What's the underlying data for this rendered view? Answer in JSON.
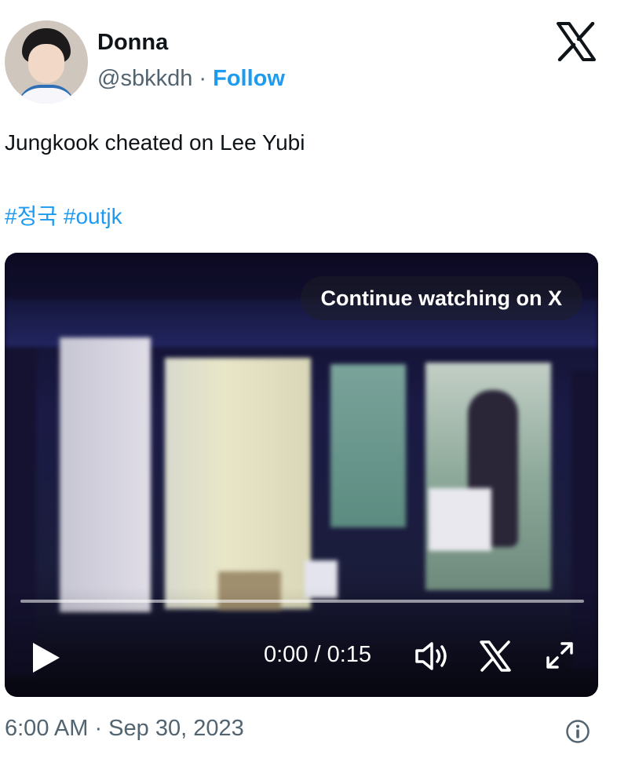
{
  "author": {
    "name": "Donna",
    "handle": "@sbkkdh",
    "separator": "·",
    "follow_label": "Follow"
  },
  "tweet": {
    "text": "Jungkook cheated on Lee Yubi",
    "hashtags": [
      "#정국",
      "#outjk"
    ]
  },
  "video": {
    "continue_label": "Continue watching on X",
    "time_display": "0:00 / 0:15",
    "progress": 0
  },
  "meta": {
    "timestamp": "6:00 AM · Sep 30, 2023"
  },
  "icons": {
    "brand": "x-logo-icon",
    "play": "play-icon",
    "volume": "volume-icon",
    "video_brand": "x-logo-icon",
    "expand": "expand-icon",
    "info": "info-icon"
  },
  "colors": {
    "accent": "#1d9bf0",
    "text": "#0f1419",
    "secondary": "#536471"
  }
}
